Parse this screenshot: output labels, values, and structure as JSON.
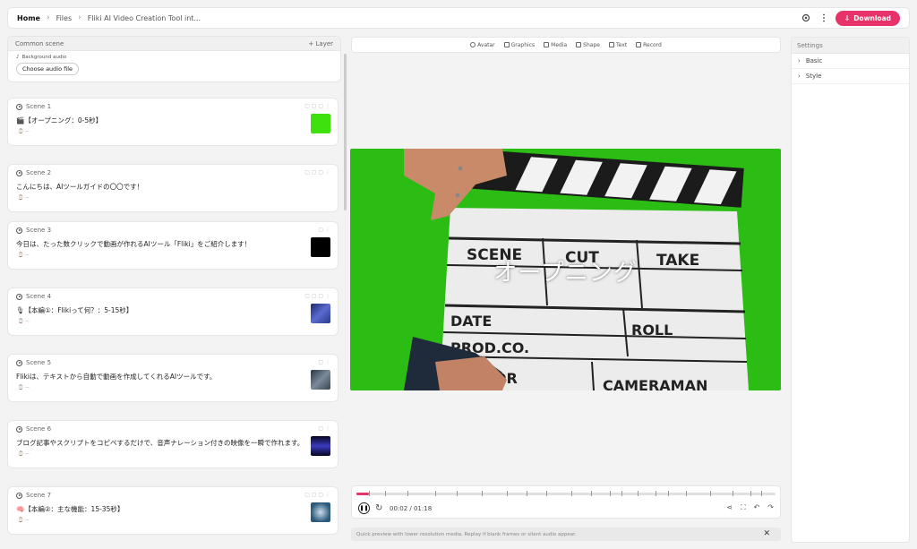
{
  "breadcrumb": {
    "home": "Home",
    "files": "Files",
    "current": "Fliki AI Video Creation Tool int..."
  },
  "topbar": {
    "download_label": "Download"
  },
  "common_scene": {
    "title": "Common scene",
    "layer_button": "+ Layer",
    "bg_audio_label": "Background audio",
    "choose_audio": "Choose audio file"
  },
  "scenes": [
    {
      "label": "Scene 1",
      "text": "🎬【オープニング：0-5秒】",
      "thumb_color": "#3ee00e"
    },
    {
      "label": "Scene 2",
      "text": "こんにちは、AIツールガイドの〇〇です！"
    },
    {
      "label": "Scene 3",
      "text": "今日は、たった数クリックで動画が作れるAIツール「Fliki」をご紹介します！",
      "thumb_color": "#000000"
    },
    {
      "label": "Scene 4",
      "text": "🎙【本編①：Flikiって何？：5-15秒】",
      "thumb_color": "#3a4aa8"
    },
    {
      "label": "Scene 5",
      "text": "Flikiは、テキストから自動で動画を作成してくれるAIツールです。",
      "thumb_color": "#4a5a6a"
    },
    {
      "label": "Scene 6",
      "text": "ブログ記事やスクリプトをコピペするだけで、音声ナレーション付きの映像を一瞬で作れます。",
      "thumb_color": "#1a1a5a"
    },
    {
      "label": "Scene 7",
      "text": "🧠【本編②：主な機能：15-35秒】",
      "thumb_color": "#2a5a7a"
    }
  ],
  "toolbar": {
    "avatar": "Avatar",
    "graphics": "Graphics",
    "media": "Media",
    "shape": "Shape",
    "text": "Text",
    "record": "Record"
  },
  "canvas": {
    "overlay_text": "オープニング"
  },
  "player": {
    "time": "00:02 / 01:18",
    "progress": 0.03
  },
  "notice": {
    "text": "Quick preview with lower resolution media. Replay if blank frames or silent audio appear."
  },
  "settings": {
    "title": "Settings",
    "basic": "Basic",
    "style": "Style"
  },
  "colors": {
    "accent": "#e8326a",
    "green_screen": "#2bbd13"
  }
}
